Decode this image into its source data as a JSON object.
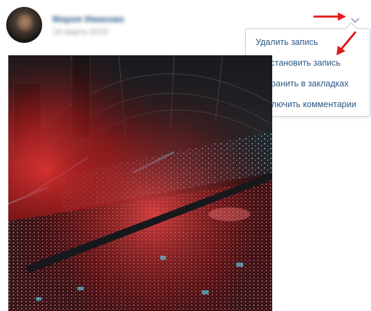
{
  "post": {
    "author_name": "Мария Иванова",
    "date": "14 марта 2019",
    "avatar": "avatar-photo",
    "photo": "concert-arena-photo"
  },
  "menu": {
    "toggle_icon": "chevron-down-icon",
    "items": [
      {
        "label": "Удалить запись"
      },
      {
        "label": "Восстановить запись"
      },
      {
        "label": "Сохранить в закладках"
      },
      {
        "label": "Выключить комментарии"
      }
    ]
  },
  "annotations": {
    "arrow_color": "#e31b1b"
  },
  "colors": {
    "link": "#2a5885",
    "menu_border": "#c5d0db",
    "muted": "#939393"
  }
}
